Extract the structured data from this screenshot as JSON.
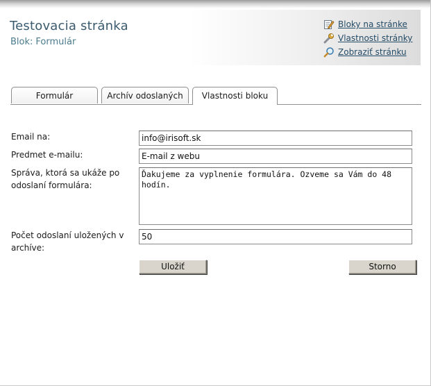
{
  "header": {
    "title": "Testovacia stránka",
    "subtitle_label": "Blok:",
    "subtitle_value": "Formulár"
  },
  "actions": [
    {
      "label": "Bloky na stránke",
      "icon": "edit-pencil-icon"
    },
    {
      "label": "Vlastnosti stránky",
      "icon": "wrench-icon"
    },
    {
      "label": "Zobraziť stránku",
      "icon": "magnifier-icon"
    }
  ],
  "tabs": [
    {
      "label": "Formulár",
      "active": false
    },
    {
      "label": "Archív odoslaných",
      "active": false
    },
    {
      "label": "Vlastnosti bloku",
      "active": true
    }
  ],
  "form": {
    "email": {
      "label": "Email na:",
      "value": "info@irisoft.sk"
    },
    "subject": {
      "label": "Predmet e-mailu:",
      "value": "E-mail z webu"
    },
    "message": {
      "label": "Správa, ktorá sa ukáže po odoslaní formulára:",
      "value": "Ďakujeme za vyplnenie formulára. Ozveme sa Vám do 48 hodín."
    },
    "archive_count": {
      "label": "Počet odoslaní uložených v archíve:",
      "value": "50"
    },
    "save_label": "Uložiť",
    "cancel_label": "Storno"
  },
  "colors": {
    "title": "#3a5a6e",
    "subtitle": "#4a7b8c",
    "link": "#244b66",
    "button_face": "#d9d5cc"
  }
}
